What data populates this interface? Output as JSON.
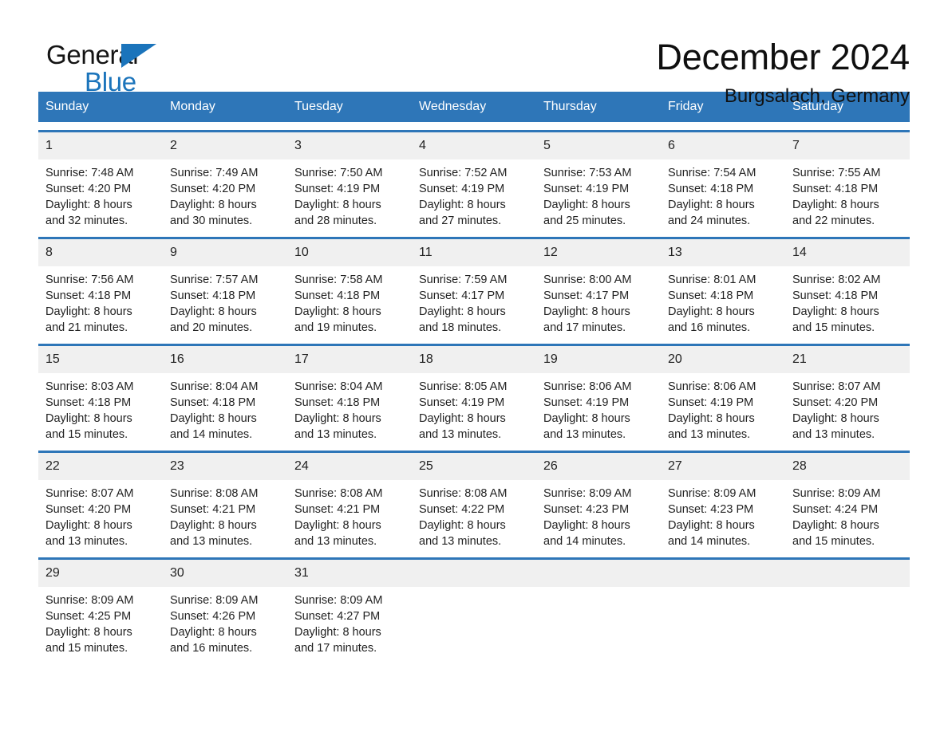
{
  "brand": {
    "name_part1": "General",
    "name_part2": "Blue",
    "accent_color": "#1b74bb"
  },
  "header": {
    "title": "December 2024",
    "location": "Burgsalach, Germany"
  },
  "calendar": {
    "header_bg": "#2e76b8",
    "daynum_bg": "#f0f0f0",
    "weekdays": [
      "Sunday",
      "Monday",
      "Tuesday",
      "Wednesday",
      "Thursday",
      "Friday",
      "Saturday"
    ],
    "weeks": [
      [
        {
          "day": "1",
          "sunrise": "Sunrise: 7:48 AM",
          "sunset": "Sunset: 4:20 PM",
          "daylight_line1": "Daylight: 8 hours",
          "daylight_line2": "and 32 minutes."
        },
        {
          "day": "2",
          "sunrise": "Sunrise: 7:49 AM",
          "sunset": "Sunset: 4:20 PM",
          "daylight_line1": "Daylight: 8 hours",
          "daylight_line2": "and 30 minutes."
        },
        {
          "day": "3",
          "sunrise": "Sunrise: 7:50 AM",
          "sunset": "Sunset: 4:19 PM",
          "daylight_line1": "Daylight: 8 hours",
          "daylight_line2": "and 28 minutes."
        },
        {
          "day": "4",
          "sunrise": "Sunrise: 7:52 AM",
          "sunset": "Sunset: 4:19 PM",
          "daylight_line1": "Daylight: 8 hours",
          "daylight_line2": "and 27 minutes."
        },
        {
          "day": "5",
          "sunrise": "Sunrise: 7:53 AM",
          "sunset": "Sunset: 4:19 PM",
          "daylight_line1": "Daylight: 8 hours",
          "daylight_line2": "and 25 minutes."
        },
        {
          "day": "6",
          "sunrise": "Sunrise: 7:54 AM",
          "sunset": "Sunset: 4:18 PM",
          "daylight_line1": "Daylight: 8 hours",
          "daylight_line2": "and 24 minutes."
        },
        {
          "day": "7",
          "sunrise": "Sunrise: 7:55 AM",
          "sunset": "Sunset: 4:18 PM",
          "daylight_line1": "Daylight: 8 hours",
          "daylight_line2": "and 22 minutes."
        }
      ],
      [
        {
          "day": "8",
          "sunrise": "Sunrise: 7:56 AM",
          "sunset": "Sunset: 4:18 PM",
          "daylight_line1": "Daylight: 8 hours",
          "daylight_line2": "and 21 minutes."
        },
        {
          "day": "9",
          "sunrise": "Sunrise: 7:57 AM",
          "sunset": "Sunset: 4:18 PM",
          "daylight_line1": "Daylight: 8 hours",
          "daylight_line2": "and 20 minutes."
        },
        {
          "day": "10",
          "sunrise": "Sunrise: 7:58 AM",
          "sunset": "Sunset: 4:18 PM",
          "daylight_line1": "Daylight: 8 hours",
          "daylight_line2": "and 19 minutes."
        },
        {
          "day": "11",
          "sunrise": "Sunrise: 7:59 AM",
          "sunset": "Sunset: 4:17 PM",
          "daylight_line1": "Daylight: 8 hours",
          "daylight_line2": "and 18 minutes."
        },
        {
          "day": "12",
          "sunrise": "Sunrise: 8:00 AM",
          "sunset": "Sunset: 4:17 PM",
          "daylight_line1": "Daylight: 8 hours",
          "daylight_line2": "and 17 minutes."
        },
        {
          "day": "13",
          "sunrise": "Sunrise: 8:01 AM",
          "sunset": "Sunset: 4:18 PM",
          "daylight_line1": "Daylight: 8 hours",
          "daylight_line2": "and 16 minutes."
        },
        {
          "day": "14",
          "sunrise": "Sunrise: 8:02 AM",
          "sunset": "Sunset: 4:18 PM",
          "daylight_line1": "Daylight: 8 hours",
          "daylight_line2": "and 15 minutes."
        }
      ],
      [
        {
          "day": "15",
          "sunrise": "Sunrise: 8:03 AM",
          "sunset": "Sunset: 4:18 PM",
          "daylight_line1": "Daylight: 8 hours",
          "daylight_line2": "and 15 minutes."
        },
        {
          "day": "16",
          "sunrise": "Sunrise: 8:04 AM",
          "sunset": "Sunset: 4:18 PM",
          "daylight_line1": "Daylight: 8 hours",
          "daylight_line2": "and 14 minutes."
        },
        {
          "day": "17",
          "sunrise": "Sunrise: 8:04 AM",
          "sunset": "Sunset: 4:18 PM",
          "daylight_line1": "Daylight: 8 hours",
          "daylight_line2": "and 13 minutes."
        },
        {
          "day": "18",
          "sunrise": "Sunrise: 8:05 AM",
          "sunset": "Sunset: 4:19 PM",
          "daylight_line1": "Daylight: 8 hours",
          "daylight_line2": "and 13 minutes."
        },
        {
          "day": "19",
          "sunrise": "Sunrise: 8:06 AM",
          "sunset": "Sunset: 4:19 PM",
          "daylight_line1": "Daylight: 8 hours",
          "daylight_line2": "and 13 minutes."
        },
        {
          "day": "20",
          "sunrise": "Sunrise: 8:06 AM",
          "sunset": "Sunset: 4:19 PM",
          "daylight_line1": "Daylight: 8 hours",
          "daylight_line2": "and 13 minutes."
        },
        {
          "day": "21",
          "sunrise": "Sunrise: 8:07 AM",
          "sunset": "Sunset: 4:20 PM",
          "daylight_line1": "Daylight: 8 hours",
          "daylight_line2": "and 13 minutes."
        }
      ],
      [
        {
          "day": "22",
          "sunrise": "Sunrise: 8:07 AM",
          "sunset": "Sunset: 4:20 PM",
          "daylight_line1": "Daylight: 8 hours",
          "daylight_line2": "and 13 minutes."
        },
        {
          "day": "23",
          "sunrise": "Sunrise: 8:08 AM",
          "sunset": "Sunset: 4:21 PM",
          "daylight_line1": "Daylight: 8 hours",
          "daylight_line2": "and 13 minutes."
        },
        {
          "day": "24",
          "sunrise": "Sunrise: 8:08 AM",
          "sunset": "Sunset: 4:21 PM",
          "daylight_line1": "Daylight: 8 hours",
          "daylight_line2": "and 13 minutes."
        },
        {
          "day": "25",
          "sunrise": "Sunrise: 8:08 AM",
          "sunset": "Sunset: 4:22 PM",
          "daylight_line1": "Daylight: 8 hours",
          "daylight_line2": "and 13 minutes."
        },
        {
          "day": "26",
          "sunrise": "Sunrise: 8:09 AM",
          "sunset": "Sunset: 4:23 PM",
          "daylight_line1": "Daylight: 8 hours",
          "daylight_line2": "and 14 minutes."
        },
        {
          "day": "27",
          "sunrise": "Sunrise: 8:09 AM",
          "sunset": "Sunset: 4:23 PM",
          "daylight_line1": "Daylight: 8 hours",
          "daylight_line2": "and 14 minutes."
        },
        {
          "day": "28",
          "sunrise": "Sunrise: 8:09 AM",
          "sunset": "Sunset: 4:24 PM",
          "daylight_line1": "Daylight: 8 hours",
          "daylight_line2": "and 15 minutes."
        }
      ],
      [
        {
          "day": "29",
          "sunrise": "Sunrise: 8:09 AM",
          "sunset": "Sunset: 4:25 PM",
          "daylight_line1": "Daylight: 8 hours",
          "daylight_line2": "and 15 minutes."
        },
        {
          "day": "30",
          "sunrise": "Sunrise: 8:09 AM",
          "sunset": "Sunset: 4:26 PM",
          "daylight_line1": "Daylight: 8 hours",
          "daylight_line2": "and 16 minutes."
        },
        {
          "day": "31",
          "sunrise": "Sunrise: 8:09 AM",
          "sunset": "Sunset: 4:27 PM",
          "daylight_line1": "Daylight: 8 hours",
          "daylight_line2": "and 17 minutes."
        },
        {
          "day": "",
          "sunrise": "",
          "sunset": "",
          "daylight_line1": "",
          "daylight_line2": ""
        },
        {
          "day": "",
          "sunrise": "",
          "sunset": "",
          "daylight_line1": "",
          "daylight_line2": ""
        },
        {
          "day": "",
          "sunrise": "",
          "sunset": "",
          "daylight_line1": "",
          "daylight_line2": ""
        },
        {
          "day": "",
          "sunrise": "",
          "sunset": "",
          "daylight_line1": "",
          "daylight_line2": ""
        }
      ]
    ]
  }
}
